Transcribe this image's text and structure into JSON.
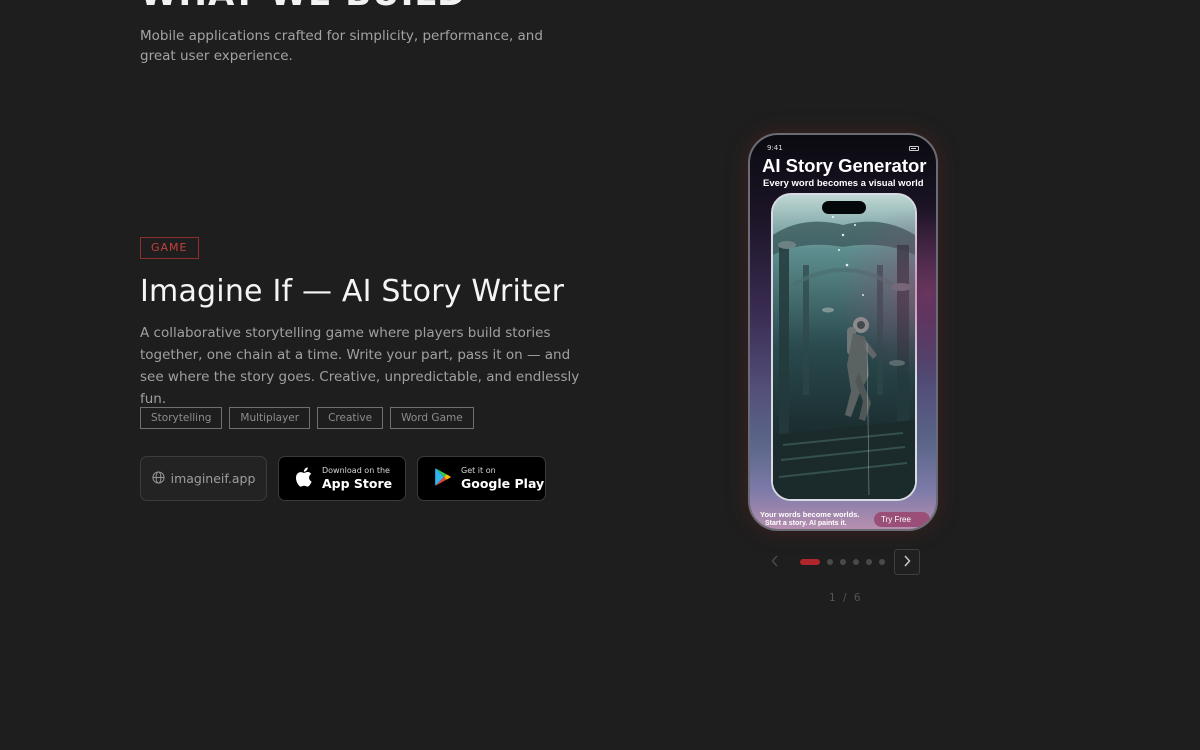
{
  "section": {
    "heading": "WHAT WE BUILD",
    "subtitle": "Mobile applications crafted for simplicity, performance, and great user experience."
  },
  "app": {
    "category": "GAME",
    "title": "Imagine If — AI Story Writer",
    "description": "A collaborative storytelling game where players build stories together, one chain at a time. Write your part, pass it on — and see where the story goes. Creative, unpredictable, and endlessly fun.",
    "tags": [
      "Storytelling",
      "Multiplayer",
      "Creative",
      "Word Game"
    ],
    "website": {
      "icon": "globe-icon",
      "label": "imagineif.app"
    },
    "app_store": {
      "icon": "apple-icon",
      "small": "Download on the",
      "big": "App Store"
    },
    "google_play": {
      "icon": "google-play-icon",
      "small": "Get it on",
      "big": "Google Play"
    }
  },
  "phone_screen": {
    "status_time": "9:41",
    "title": "AI Story Generator",
    "subtitle": "Every word becomes a visual world",
    "footer_line1": "Your words become worlds.",
    "footer_line2": "Start a story.  AI paints it.",
    "cta": "Try Free"
  },
  "carousel": {
    "prev_icon": "chevron-left-icon",
    "next_icon": "chevron-right-icon",
    "current": 1,
    "total": 6,
    "counter_text": "1 / 6"
  },
  "colors": {
    "background": "#1e1e1e",
    "accent": "#b0262a",
    "badge_text": "#c2413b"
  }
}
